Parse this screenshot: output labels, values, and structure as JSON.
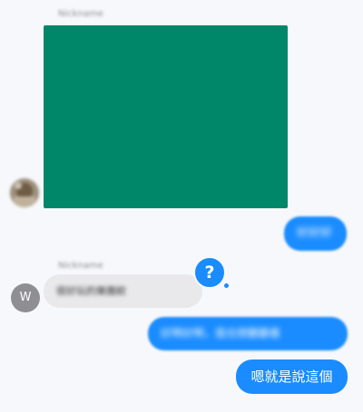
{
  "thread": {
    "sender_name_top": "Nickname",
    "image_message": {
      "fill_color": "#00876a"
    },
    "outgoing_1": "好好好",
    "sender_name_mid": "Nickname",
    "incoming_avatar_initial": "W",
    "incoming_1": "很好玩的樂團欸",
    "reaction_glyph": "?",
    "outgoing_2": "好啊好啊，我也想聽聽看",
    "outgoing_3": "嗯就是說這個"
  },
  "colors": {
    "outgoing_bubble": "#1a8cff",
    "incoming_bubble": "#e9e9eb",
    "background": "#f7f8fb",
    "image_placeholder": "#00876a",
    "avatar_grey": "#8e8e93"
  },
  "icons": {
    "reaction": "question-mark-reaction-icon"
  }
}
